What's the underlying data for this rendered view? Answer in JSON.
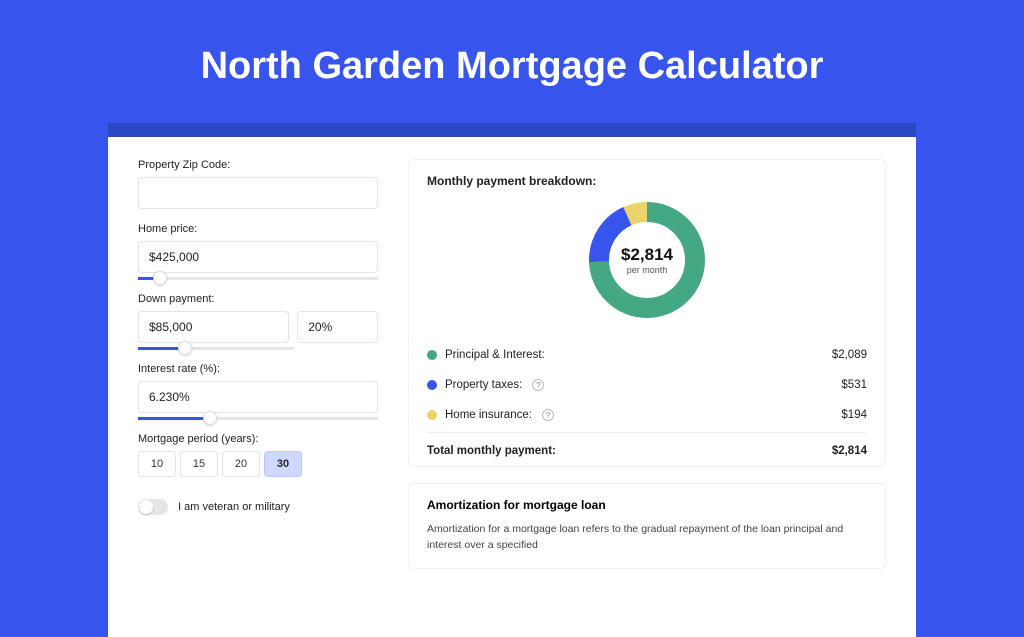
{
  "header": {
    "title": "North Garden Mortgage Calculator"
  },
  "form": {
    "zip_label": "Property Zip Code:",
    "zip_value": "",
    "home_price_label": "Home price:",
    "home_price_value": "$425,000",
    "home_price_slider_pct": 9,
    "down_label": "Down payment:",
    "down_value": "$85,000",
    "down_pct_value": "20%",
    "down_slider_pct": 20,
    "rate_label": "Interest rate (%):",
    "rate_value": "6.230%",
    "rate_slider_pct": 30,
    "period_label": "Mortgage period (years):",
    "period_options": [
      "10",
      "15",
      "20",
      "30"
    ],
    "period_selected": "30",
    "veteran_label": "I am veteran or military"
  },
  "breakdown": {
    "title": "Monthly payment breakdown:",
    "total": "$2,814",
    "per_month": "per month",
    "items": [
      {
        "label": "Principal & Interest:",
        "value": "$2,089",
        "color": "green"
      },
      {
        "label": "Property taxes:",
        "value": "$531",
        "color": "blue",
        "help": true
      },
      {
        "label": "Home insurance:",
        "value": "$194",
        "color": "yellow",
        "help": true
      }
    ],
    "total_label": "Total monthly payment:",
    "total_value": "$2,814"
  },
  "amort": {
    "title": "Amortization for mortgage loan",
    "text": "Amortization for a mortgage loan refers to the gradual repayment of the loan principal and interest over a specified"
  },
  "chart_data": {
    "type": "pie",
    "title": "Monthly payment breakdown",
    "total_label": "$2,814 per month",
    "series": [
      {
        "name": "Principal & Interest",
        "value": 2089,
        "color": "#44a882"
      },
      {
        "name": "Property taxes",
        "value": 531,
        "color": "#3755ed"
      },
      {
        "name": "Home insurance",
        "value": 194,
        "color": "#ecd36a"
      }
    ]
  }
}
